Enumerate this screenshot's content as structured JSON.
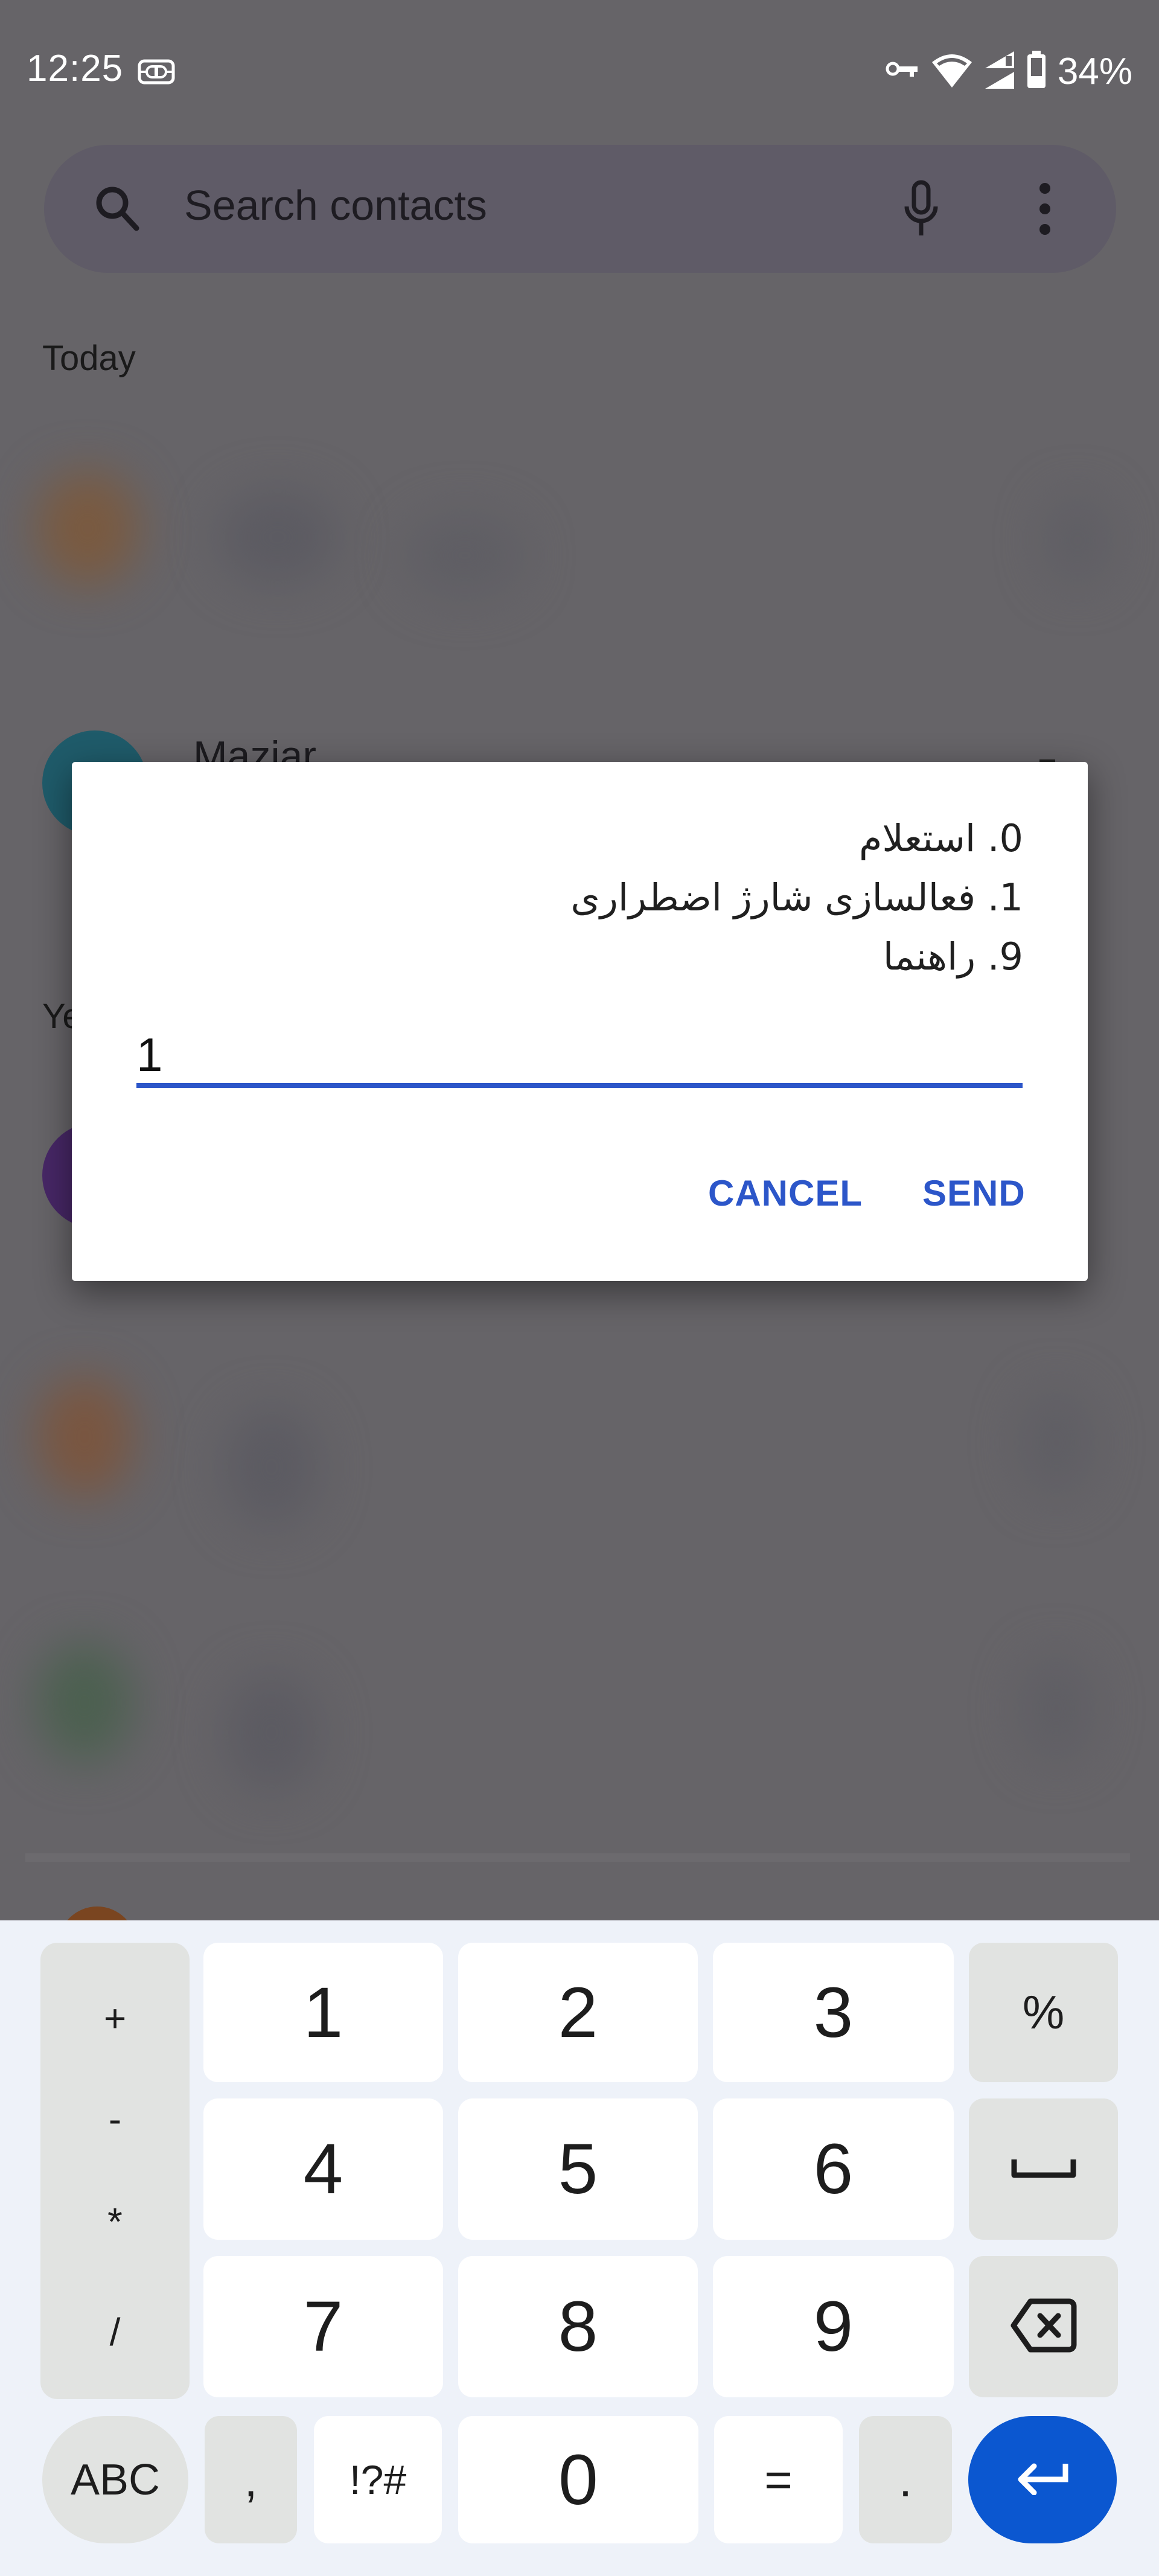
{
  "status_bar": {
    "time": "12:25",
    "battery_percent": "34%",
    "icons_left": [
      "connection-icon"
    ],
    "icons_right": [
      "vpn-key-icon",
      "wifi-icon",
      "signal-icon",
      "battery-icon"
    ]
  },
  "search": {
    "placeholder": "Search contacts",
    "icons": [
      "search-icon",
      "mic-icon",
      "more-vert-icon"
    ]
  },
  "call_log": {
    "sections": [
      {
        "label": "Today"
      },
      {
        "label": "Ye"
      }
    ],
    "visible_contact_name": "Maziar"
  },
  "ussd_dialog": {
    "menu_lines": [
      "0. استعلام",
      "1. فعالسازی شارژ اضطراری",
      "9. راهنما"
    ],
    "input_value": "1",
    "cancel_label": "CANCEL",
    "send_label": "SEND",
    "accent_color": "#2c56c9"
  },
  "keyboard": {
    "operator_keys": [
      "+",
      "-",
      "*",
      "/"
    ],
    "rows": [
      [
        "1",
        "2",
        "3"
      ],
      [
        "4",
        "5",
        "6"
      ],
      [
        "7",
        "8",
        "9"
      ]
    ],
    "right_keys": [
      "%",
      "space-icon",
      "backspace-icon"
    ],
    "bottom_row": {
      "abc": "ABC",
      "comma": ",",
      "symbols": "!?#",
      "zero": "0",
      "equals": "=",
      "period": ".",
      "enter": "enter-icon"
    },
    "enter_color": "#0b57d0"
  }
}
